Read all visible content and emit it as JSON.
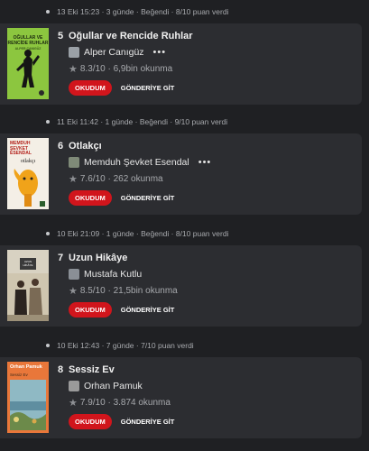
{
  "feed": {
    "items": [
      {
        "meta": "13 Eki 15:23 · 3 günde · Beğendi · 8/10 puan verdi",
        "rank": "5",
        "title": "Oğullar ve Rencide Ruhlar",
        "author": "Alper Canıgüz",
        "rating": "8.3/10 · 6,9bin okunma",
        "cover_text": [
          "OĞULLAR VE",
          "RENCİDE RUHLAR",
          "ALPER CANIGÜZ"
        ],
        "read_label": "OKUDUM",
        "send_label": "GÖNDERİYE GİT",
        "more": "•••"
      },
      {
        "meta": "11 Eki 11:42 · 1 günde · Beğendi · 9/10 puan verdi",
        "rank": "6",
        "title": "Otlakçı",
        "author": "Memduh Şevket Esendal",
        "rating": "7.6/10 · 262 okunma",
        "cover_text": [
          "MEMDUH",
          "ŞEVKET",
          "ESENDAL",
          "otlakçı"
        ],
        "read_label": "OKUDUM",
        "send_label": "GÖNDERİYE GİT",
        "more": "•••"
      },
      {
        "meta": "10 Eki 21:09 · 1 günde · Beğendi · 8/10 puan verdi",
        "rank": "7",
        "title": "Uzun Hikâye",
        "author": "Mustafa Kutlu",
        "rating": "8.5/10 · 21,5bin okunma",
        "cover_text": [
          "UZUN",
          "HİKÂYE"
        ],
        "read_label": "OKUDUM",
        "send_label": "GÖNDERİYE GİT",
        "more": ""
      },
      {
        "meta": "10 Eki 12:43 · 7 günde · 7/10 puan verdi",
        "rank": "8",
        "title": "Sessiz Ev",
        "author": "Orhan Pamuk",
        "rating": "7.9/10 · 3.874 okunma",
        "cover_text": [
          "Orhan Pamuk",
          "Sessiz Ev"
        ],
        "read_label": "OKUDUM",
        "send_label": "GÖNDERİYE GİT",
        "more": ""
      }
    ]
  },
  "colors": {
    "background": "#1f2023",
    "card": "#2c2d31",
    "accent_red": "#d1151c",
    "muted_text": "#a7a9ad"
  },
  "icons": {
    "meta_dot": "dot-icon",
    "rating": "star-icon",
    "more": "more-icon"
  }
}
